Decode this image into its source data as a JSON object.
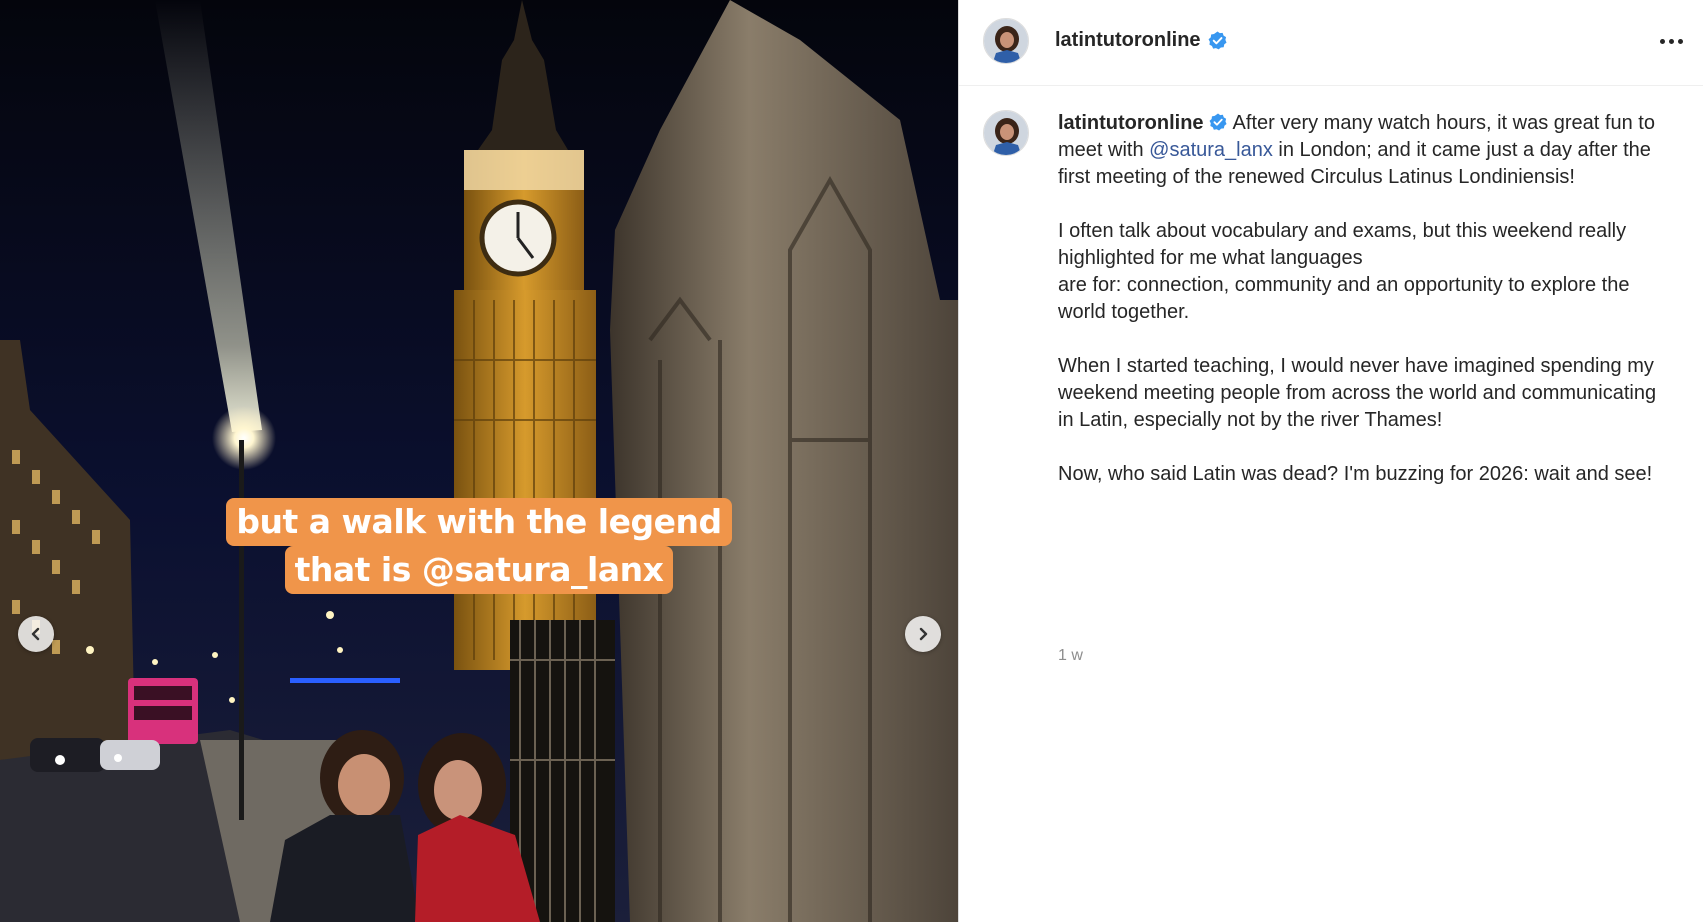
{
  "post": {
    "media": {
      "overlay_lines": [
        "but a walk with the legend",
        "that is @satura_lanx"
      ],
      "prev_icon": "chevron-left-icon",
      "next_icon": "chevron-right-icon"
    },
    "header": {
      "username": "latintutoronline",
      "verified_icon": "verified-badge-icon",
      "more_icon": "more-options-icon"
    },
    "caption": {
      "author": "latintutoronline",
      "part1": "After very many watch hours, it was great fun to meet with ",
      "mention": "@satura_lanx",
      "part2": " in London; and it came just a day after the first meeting of the renewed Circulus Latinus Londiniensis!\n\nI often talk about vocabulary and exams, but this weekend really highlighted for me what languages\nare for: connection, community and an opportunity to explore the world together.\n\nWhen I started teaching, I would never have imagined spending my weekend meeting people from across the world and communicating in Latin, especially not by the river Thames!\n\nNow, who said Latin was dead? I'm buzzing for 2026: wait and see!",
      "timestamp": "1 w"
    },
    "colors": {
      "overlay_bg": "#f0954a",
      "verified": "#3897f0",
      "mention": "#385898"
    }
  }
}
